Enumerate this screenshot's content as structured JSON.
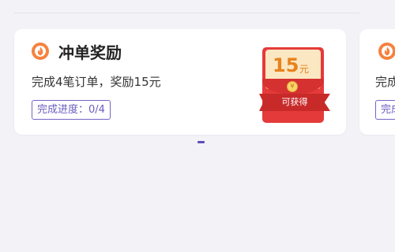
{
  "reward_cards": [
    {
      "title": "冲单奖励",
      "description": "完成4笔订单，奖励15元",
      "progress_label": "完成进度：0/4",
      "red_packet": {
        "amount": "15",
        "unit": "元",
        "ribbon_label": "可获得"
      }
    },
    {
      "description": "完成",
      "progress_label": "完成"
    }
  ],
  "pager": {
    "current_index": 0
  },
  "colors": {
    "accent": "#5c4fb8",
    "icon_orange": "#f5823e",
    "red_packet": "#e53a3a",
    "amount": "#e8821c"
  }
}
